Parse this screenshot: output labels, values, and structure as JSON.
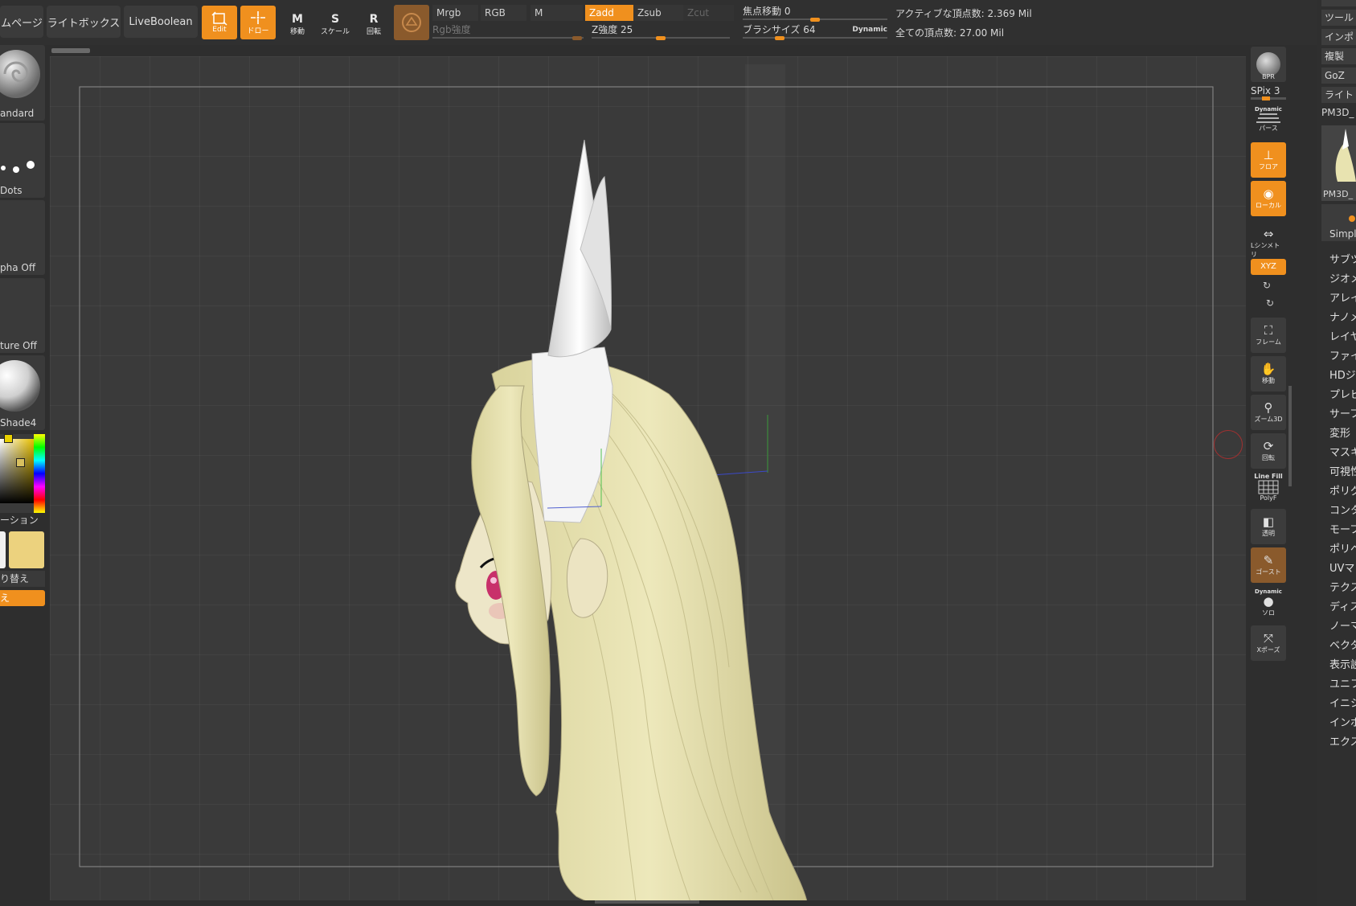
{
  "top": {
    "page_label": "ムページ",
    "lightbox_label": "ライトボックス",
    "liveboolean_label": "LiveBoolean",
    "edit_label": "Edit",
    "draw_label": "ドロー",
    "move_label": "移動",
    "move_glyph": "M",
    "scale_label": "スケール",
    "scale_glyph": "S",
    "rotate_label": "回転",
    "rotate_glyph": "R",
    "mrgb": "Mrgb",
    "rgb": "RGB",
    "m": "M",
    "zadd": "Zadd",
    "zsub": "Zsub",
    "zcut": "Zcut",
    "rgb_intensity": "Rgb強度",
    "z_intensity": "Z強度 25",
    "focal_shift": "焦点移動 0",
    "draw_size": "ブラシサイズ 64",
    "dynamic": "Dynamic",
    "active_points": "アクティブな頂点数: 2.369 Mil",
    "total_points": "全ての頂点数: 27.00 Mil",
    "z_intensity_value": 25,
    "focal_value": 0,
    "draw_size_value": 64
  },
  "left": {
    "brush_label": "andard",
    "stroke_label": "Dots",
    "alpha_label": "pha Off",
    "texture_label": "ture Off",
    "material_label": "Shade4",
    "gradient_label": "ーション",
    "switch_label": "り替え",
    "alt_label": "え"
  },
  "right": {
    "bpr": "BPR",
    "spix": "SPix 3",
    "dynamic": "Dynamic",
    "persp": "パース",
    "floor": "フロア",
    "local": "ローカル",
    "lsym": "Lシンメトリ",
    "xyz": "XYZ",
    "frame": "フレーム",
    "move": "移動",
    "zoom": "ズーム3D",
    "rotate": "回転",
    "linefill": "Line Fill",
    "polyf": "PolyF",
    "transp": "透明",
    "ghost": "ゴースト",
    "solo_dynamic": "Dynamic",
    "solo": "ソロ",
    "xpose": "Xポーズ"
  },
  "palette": {
    "tool": "ツール",
    "import": "インポ",
    "clone": "複製",
    "goz": "GoZ",
    "lightbox": "ライト",
    "toolname": "PM3D_",
    "thumb_label": "PM3D_",
    "simple": "Simpl",
    "menu": [
      "サブツ",
      "ジオメ",
      "アレイ",
      "ナノメ",
      "レイヤ",
      "ファイ",
      "HDジオ",
      "プレビ",
      "サーフ",
      "変形",
      "マスキ",
      "可視性",
      "ポリグ",
      "コンタ",
      "モーフ",
      "ポリペ",
      "UVマッ",
      "テクス",
      "ディス",
      "ノーマ",
      "ベクタ",
      "表示設",
      "ユニフ",
      "イニシ",
      "インポ",
      "エクス"
    ]
  },
  "colors": {
    "accent": "#f0901e",
    "hair": "#e8e3b0",
    "horn": "#e6e6e6",
    "secondary_color": "#ecd27e"
  }
}
